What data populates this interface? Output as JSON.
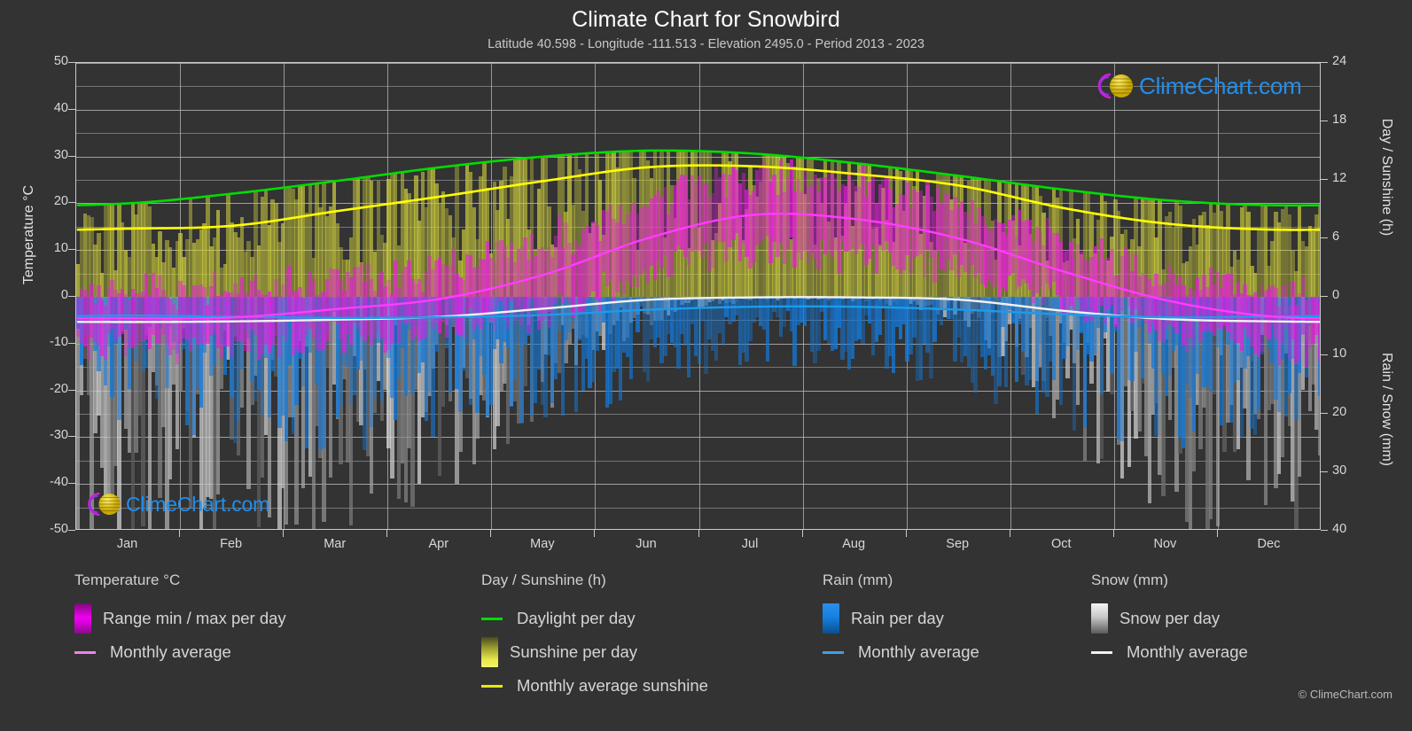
{
  "header": {
    "title": "Climate Chart for Snowbird",
    "subtitle": "Latitude 40.598 - Longitude -111.513 - Elevation 2495.0 - Period 2013 - 2023"
  },
  "axes": {
    "left_label": "Temperature °C",
    "right_label_top": "Day / Sunshine (h)",
    "right_label_bottom": "Rain / Snow (mm)",
    "left_ticks": [
      "50",
      "40",
      "30",
      "20",
      "10",
      "0",
      "-10",
      "-20",
      "-30",
      "-40",
      "-50"
    ],
    "right_ticks_top": [
      "24",
      "18",
      "12",
      "6",
      "0"
    ],
    "right_ticks_bottom": [
      "0",
      "10",
      "20",
      "30",
      "40"
    ],
    "months": [
      "Jan",
      "Feb",
      "Mar",
      "Apr",
      "May",
      "Jun",
      "Jul",
      "Aug",
      "Sep",
      "Oct",
      "Nov",
      "Dec"
    ]
  },
  "watermark": {
    "text": "ClimeChart.com",
    "copyright": "© ClimeChart.com"
  },
  "legend": {
    "columns": [
      {
        "title": "Temperature °C",
        "items": [
          {
            "label": "Range min / max per day",
            "marker": "swatch",
            "color": "#ee00ee"
          },
          {
            "label": "Monthly average",
            "marker": "line",
            "color": "#f080f0"
          }
        ]
      },
      {
        "title": "Day / Sunshine (h)",
        "items": [
          {
            "label": "Daylight per day",
            "marker": "line",
            "color": "#00dd00"
          },
          {
            "label": "Sunshine per day",
            "marker": "swatch",
            "color": "#e8e84a"
          },
          {
            "label": "Monthly average sunshine",
            "marker": "line",
            "color": "#e8e810"
          }
        ]
      },
      {
        "title": "Rain (mm)",
        "items": [
          {
            "label": "Rain per day",
            "marker": "swatch",
            "color": "#1580e0"
          },
          {
            "label": "Monthly average",
            "marker": "line",
            "color": "#3f9fe8"
          }
        ]
      },
      {
        "title": "Snow (mm)",
        "items": [
          {
            "label": "Snow per day",
            "marker": "swatch",
            "color": "#e6e6e6"
          },
          {
            "label": "Monthly average",
            "marker": "line",
            "color": "#f2f2f2"
          }
        ]
      }
    ]
  },
  "chart_data": {
    "type": "line",
    "title": "Climate Chart for Snowbird",
    "subtitle": "Latitude 40.598 - Longitude -111.513 - Elevation 2495.0 - Period 2013 - 2023",
    "xlabel": "",
    "ylabel": "Temperature °C",
    "ylabel_right_top": "Day / Sunshine (h)",
    "ylabel_right_bottom": "Rain / Snow (mm)",
    "ylim": [
      -50,
      50
    ],
    "ylim_right_top": [
      0,
      24
    ],
    "ylim_right_bottom": [
      40,
      0
    ],
    "grid": true,
    "legend_position": "below",
    "categories": [
      "Jan",
      "Feb",
      "Mar",
      "Apr",
      "May",
      "Jun",
      "Jul",
      "Aug",
      "Sep",
      "Oct",
      "Nov",
      "Dec"
    ],
    "series": [
      {
        "name": "Monthly average temperature",
        "unit": "°C",
        "axis": "left",
        "color": "#ff3cff",
        "values": [
          -4.6,
          -4.4,
          -2.6,
          -0.4,
          4.8,
          12.6,
          17.5,
          16.6,
          12.4,
          5.4,
          -0.8,
          -4.2
        ]
      },
      {
        "name": "Daylight per day",
        "unit": "h",
        "axis": "right_top",
        "color": "#00dd00",
        "values": [
          9.6,
          10.6,
          11.9,
          13.3,
          14.4,
          15.0,
          14.7,
          13.7,
          12.4,
          11.0,
          9.9,
          9.4
        ]
      },
      {
        "name": "Monthly average sunshine",
        "unit": "h",
        "axis": "right_top",
        "color": "#ffff00",
        "values": [
          7.0,
          7.3,
          8.8,
          10.3,
          11.9,
          13.3,
          13.4,
          12.6,
          11.4,
          9.1,
          7.5,
          6.9
        ]
      },
      {
        "name": "Monthly average rain",
        "unit": "mm",
        "axis": "right_bottom",
        "color": "#1e9be8",
        "values": [
          3.2,
          3.4,
          3.6,
          3.5,
          3.1,
          2.2,
          1.7,
          1.7,
          2.2,
          3.0,
          3.5,
          3.4
        ]
      },
      {
        "name": "Monthly average snow",
        "unit": "mm",
        "axis": "right_bottom",
        "color": "#f2f2f2",
        "values": [
          4.3,
          4.2,
          3.9,
          3.4,
          2.0,
          0.5,
          0.1,
          0.1,
          0.5,
          2.4,
          3.8,
          4.2
        ]
      },
      {
        "name": "Temperature range max per day",
        "unit": "°C",
        "axis": "left",
        "color": "#ee00ee",
        "values": [
          0.4,
          0.8,
          3.1,
          5.4,
          11.2,
          19.6,
          24.4,
          23.3,
          18.8,
          11.2,
          4.2,
          0.6
        ]
      },
      {
        "name": "Temperature range min per day",
        "unit": "°C",
        "axis": "left",
        "color": "#b800b8",
        "values": [
          -9.8,
          -9.6,
          -8.2,
          -6.1,
          -1.6,
          5.4,
          10.4,
          9.8,
          6.0,
          -0.4,
          -5.8,
          -9.2
        ]
      },
      {
        "name": "Sunshine per day",
        "unit": "h",
        "axis": "right_top",
        "color": "#d4d440",
        "values": [
          7.0,
          7.3,
          8.8,
          10.3,
          11.9,
          13.3,
          13.4,
          12.6,
          11.4,
          9.1,
          7.5,
          6.9
        ]
      },
      {
        "name": "Rain per day",
        "unit": "mm",
        "axis": "right_bottom",
        "color": "#1580e0",
        "values": [
          3.2,
          3.4,
          3.6,
          3.5,
          3.1,
          2.2,
          1.7,
          1.7,
          2.2,
          3.0,
          3.5,
          3.4
        ]
      },
      {
        "name": "Snow per day",
        "unit": "mm",
        "axis": "right_bottom",
        "color": "#bdbdbd",
        "values": [
          4.3,
          4.2,
          3.9,
          3.4,
          2.0,
          0.5,
          0.1,
          0.1,
          0.5,
          2.4,
          3.8,
          4.2
        ]
      }
    ]
  }
}
